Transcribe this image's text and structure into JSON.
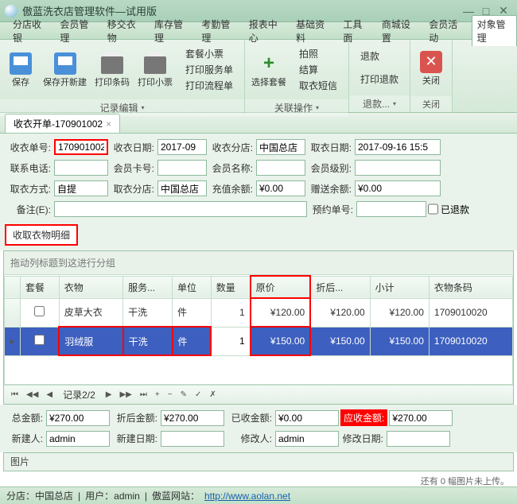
{
  "window": {
    "title": "傲蓝洗衣店管理软件—试用版"
  },
  "menu": [
    "分店收银",
    "会员管理",
    "移交衣物",
    "库存管理",
    "考勤管理",
    "报表中心",
    "基础资料",
    "工具面",
    "商城设置",
    "会员活动",
    "对象管理"
  ],
  "ribbon": {
    "g1": {
      "save": "保存",
      "saveNew": "保存开新建",
      "barcode": "打印条码",
      "ticket": "打印小票",
      "label": "记录编辑",
      "list": [
        "套餐小票",
        "打印服务单",
        "打印流程单"
      ]
    },
    "g2": {
      "select": "选择套餐",
      "label": "关联操作",
      "list": [
        "拍照",
        "结算",
        "取衣短信"
      ]
    },
    "g3": {
      "refund": "退款",
      "refundPrint": "打印退款",
      "label": "退款..."
    },
    "g4": {
      "close": "关闭",
      "label": "关闭"
    }
  },
  "tab": {
    "title": "收衣开单-170901002"
  },
  "form": {
    "f1": {
      "l": "收衣单号:",
      "v": "170901002"
    },
    "f2": {
      "l": "收衣日期:",
      "v": "2017-09"
    },
    "f3": {
      "l": "收衣分店:",
      "v": "中国总店"
    },
    "f4": {
      "l": "取衣日期:",
      "v": "2017-09-16 15:5"
    },
    "f5": {
      "l": "联系电话:",
      "v": ""
    },
    "f6": {
      "l": "会员卡号:",
      "v": ""
    },
    "f7": {
      "l": "会员名称:",
      "v": ""
    },
    "f8": {
      "l": "会员级别:",
      "v": ""
    },
    "f9": {
      "l": "取衣方式:",
      "v": "自提"
    },
    "f10": {
      "l": "取衣分店:",
      "v": "中国总店"
    },
    "f11": {
      "l": "充值余额:",
      "v": "¥0.00"
    },
    "f12": {
      "l": "赠送余额:",
      "v": "¥0.00"
    },
    "f13": {
      "l": "备注(E):",
      "v": ""
    },
    "f14": {
      "l": "预约单号:",
      "v": ""
    },
    "chkRefund": "已退款"
  },
  "detailTab": "收取衣物明细",
  "grid": {
    "grouphint": "拖动列标题到这进行分组",
    "cols": [
      "套餐",
      "衣物",
      "服务...",
      "单位",
      "数量",
      "原价",
      "折后...",
      "小计",
      "衣物条码"
    ],
    "rows": [
      {
        "item": "皮草大衣",
        "svc": "干洗",
        "unit": "件",
        "qty": "1",
        "price": "¥120.00",
        "disc": "¥120.00",
        "sub": "¥120.00",
        "code": "1709010020"
      },
      {
        "item": "羽绒服",
        "svc": "干洗",
        "unit": "件",
        "qty": "1",
        "price": "¥150.00",
        "disc": "¥150.00",
        "sub": "¥150.00",
        "code": "1709010020"
      }
    ],
    "nav": "记录2/2"
  },
  "summary": {
    "total": {
      "l": "总金额:",
      "v": "¥270.00"
    },
    "afterDisc": {
      "l": "折后金额:",
      "v": "¥270.00"
    },
    "paid": {
      "l": "已收金额:",
      "v": "¥0.00"
    },
    "due": {
      "l": "应收金额:",
      "v": "¥270.00"
    },
    "creator": {
      "l": "新建人:",
      "v": "admin"
    },
    "created": {
      "l": "新建日期:",
      "v": ""
    },
    "modifier": {
      "l": "修改人:",
      "v": "admin"
    },
    "modified": {
      "l": "修改日期:",
      "v": ""
    }
  },
  "pic": {
    "label": "图片",
    "hint": "还有 0 幅图片未上传。"
  },
  "status": {
    "branch": "分店：中国总店",
    "user": "用户：admin",
    "sitelabel": "傲蓝网站：",
    "url": "http://www.aolan.net"
  }
}
